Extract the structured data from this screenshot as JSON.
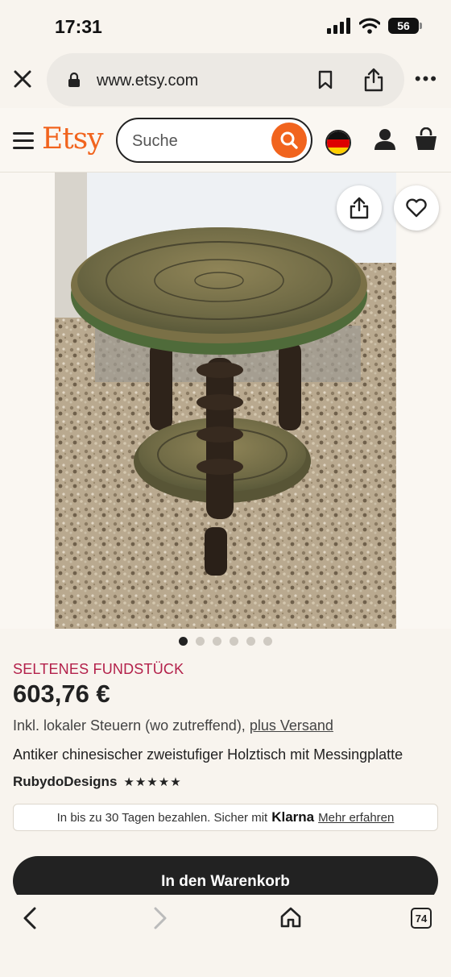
{
  "status_bar": {
    "time": "17:31",
    "battery": "56"
  },
  "browser": {
    "url": "www.etsy.com"
  },
  "header": {
    "logo": "Etsy",
    "search_placeholder": "Suche"
  },
  "listing": {
    "badge": "SELTENES FUNDSTÜCK",
    "price": "603,76 €",
    "tax_text": "Inkl. lokaler Steuern (wo zutreffend), ",
    "shipping_link": "plus Versand",
    "title": "Antiker chinesischer zweistufiger Holztisch mit Messingplatte",
    "seller": "RubydoDesigns",
    "rating_stars": "★★★★★",
    "image_count": 6,
    "active_image": 1
  },
  "klarna": {
    "text": "In bis zu 30 Tagen bezahlen. Sicher mit",
    "brand": "Klarna",
    "link": "Mehr erfahren"
  },
  "cart_button": "In den Warenkorb",
  "bottom_nav": {
    "tab_count": "74"
  },
  "colors": {
    "brand": "#f1641e",
    "badge": "#b3204a",
    "background": "#f8f4ee"
  }
}
